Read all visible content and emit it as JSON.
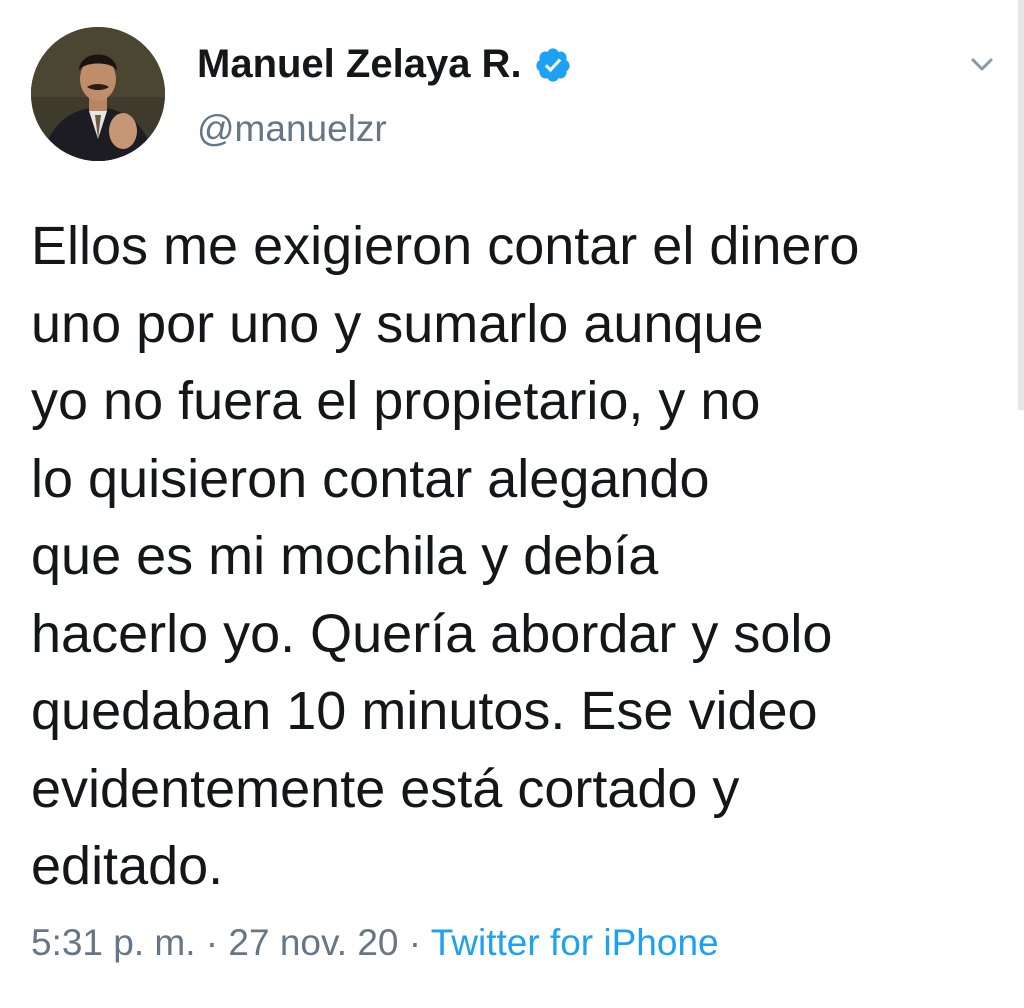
{
  "author": {
    "name": "Manuel Zelaya R.",
    "handle": "@manuelzr",
    "verified": true
  },
  "tweet": {
    "text": "Ellos me exigieron contar el dinero\nuno por uno y sumarlo aunque\nyo no fuera el propietario, y no\nlo quisieron contar alegando\nque es mi mochila y debía\nhacerlo yo. Quería abordar y solo\nquedaban 10 minutos. Ese video\nevidentemente está cortado y\neditado."
  },
  "meta": {
    "time": "5:31 p. m.",
    "separator": " · ",
    "date": "27 nov. 20",
    "source": "Twitter for iPhone"
  },
  "icons": {
    "verified": "verified-badge-icon",
    "menu": "chevron-down-icon"
  },
  "colors": {
    "accent": "#1da1f2",
    "secondary_text": "#657786",
    "primary_text": "#14171a"
  }
}
